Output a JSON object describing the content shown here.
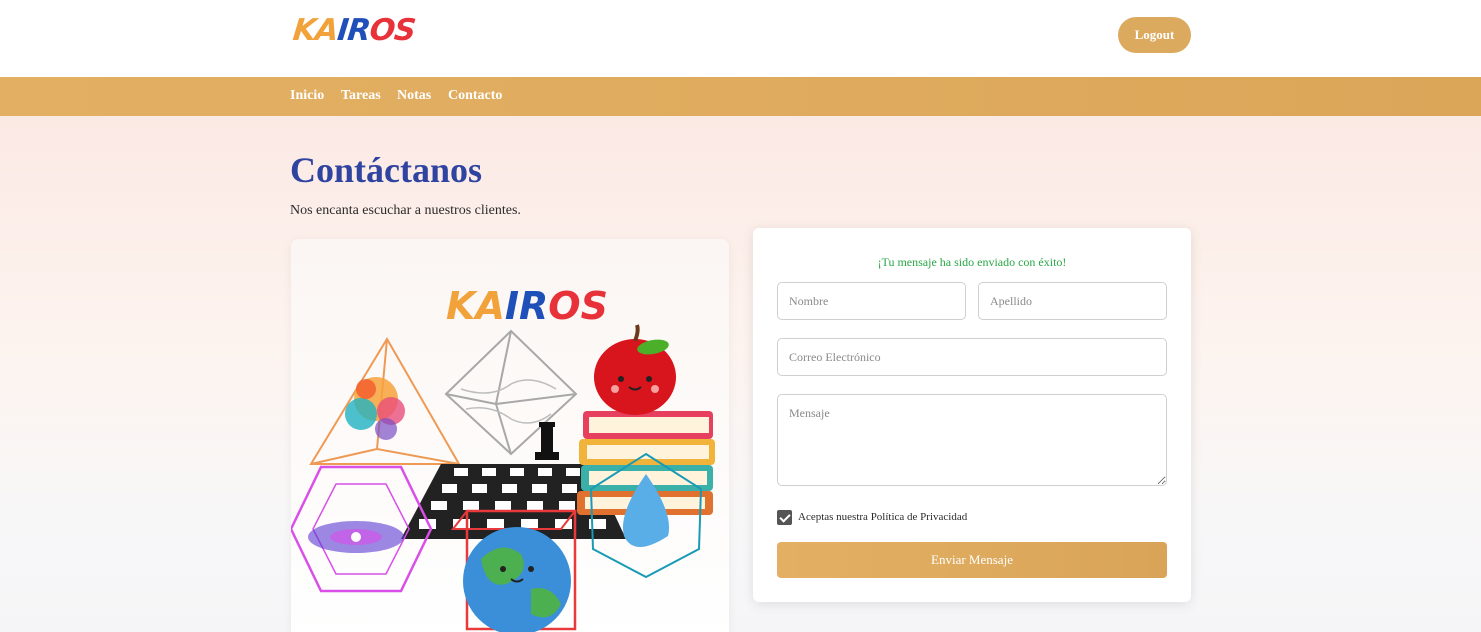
{
  "header": {
    "logo": [
      "KA",
      "IR",
      "OS"
    ],
    "logout_label": "Logout"
  },
  "nav": {
    "items": [
      {
        "label": "Inicio"
      },
      {
        "label": "Tareas"
      },
      {
        "label": "Notas"
      },
      {
        "label": "Contacto"
      }
    ]
  },
  "main": {
    "title": "Contáctanos",
    "subtitle": "Nos encanta escuchar a nuestros clientes."
  },
  "image_card": {
    "logo": [
      "KA",
      "IR",
      "OS"
    ],
    "illustration": "education-collage"
  },
  "form": {
    "success_message": "¡Tu mensaje ha sido enviado con éxito!",
    "first_name_placeholder": "Nombre",
    "last_name_placeholder": "Apellido",
    "email_placeholder": "Correo Electrónico",
    "message_placeholder": "Mensaje",
    "privacy_label": "Aceptas nuestra Política de Privacidad",
    "privacy_checked": true,
    "submit_label": "Enviar Mensaje"
  },
  "colors": {
    "accent": "#dcaa5e",
    "title": "#2f44a0",
    "success": "#28a745",
    "logo_orange": "#f2a23a",
    "logo_blue": "#1f4fb8",
    "logo_red": "#e8323a"
  }
}
